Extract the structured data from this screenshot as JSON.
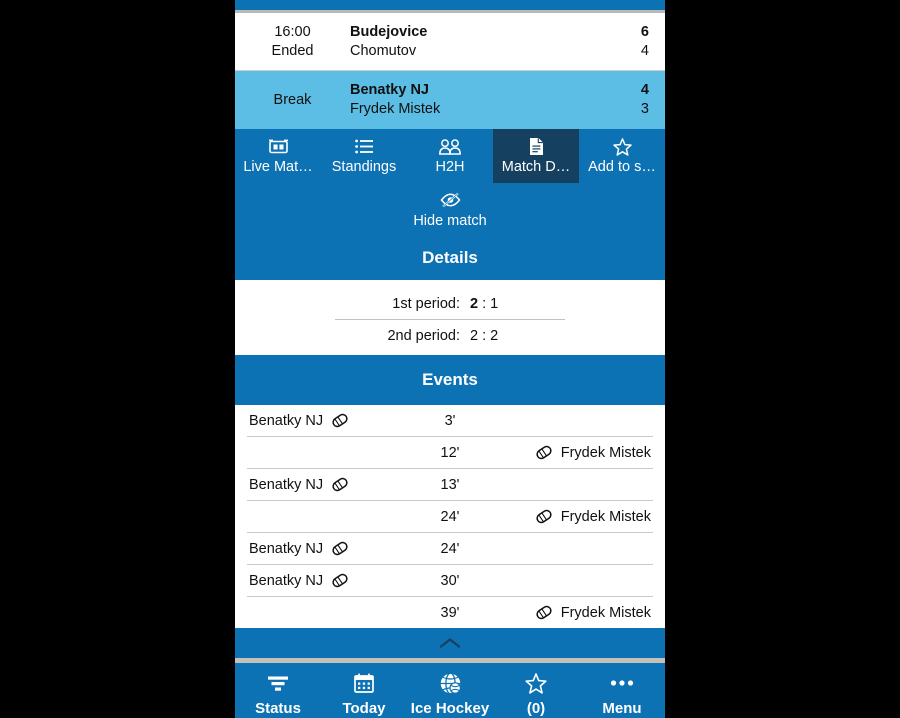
{
  "matches": [
    {
      "time": "16:00",
      "status": "Ended",
      "home_team": "Budejovice",
      "away_team": "Chomutov",
      "home_score": "6",
      "away_score": "4",
      "highlighted": false
    },
    {
      "time": "",
      "status": "Break",
      "home_team": "Benatky NJ",
      "away_team": "Frydek Mistek",
      "home_score": "4",
      "away_score": "3",
      "highlighted": true
    }
  ],
  "tabs": [
    {
      "label": "Live Mat…",
      "icon": "scoreboard-icon",
      "active": false
    },
    {
      "label": "Standings",
      "icon": "list-icon",
      "active": false
    },
    {
      "label": "H2H",
      "icon": "two-people-icon",
      "active": false
    },
    {
      "label": "Match D…",
      "icon": "document-icon",
      "active": true
    },
    {
      "label": "Add to s…",
      "icon": "star-icon",
      "active": false
    }
  ],
  "hide_match": {
    "label": "Hide match",
    "icon": "eye-slash-icon"
  },
  "details": {
    "title": "Details",
    "periods": [
      {
        "label": "1st period:",
        "home": "2",
        "away": "1",
        "bold_home": true
      },
      {
        "label": "2nd period:",
        "home": "2",
        "away": "2",
        "bold_home": false
      }
    ]
  },
  "events": {
    "title": "Events",
    "rows": [
      {
        "side": "left",
        "team": "Benatky NJ",
        "minute": "3'",
        "icon": "hockey-puck-icon"
      },
      {
        "side": "right",
        "team": "Frydek Mistek",
        "minute": "12'",
        "icon": "hockey-puck-icon"
      },
      {
        "side": "left",
        "team": "Benatky NJ",
        "minute": "13'",
        "icon": "hockey-puck-icon"
      },
      {
        "side": "right",
        "team": "Frydek Mistek",
        "minute": "24'",
        "icon": "hockey-puck-icon"
      },
      {
        "side": "left",
        "team": "Benatky NJ",
        "minute": "24'",
        "icon": "hockey-puck-icon"
      },
      {
        "side": "left",
        "team": "Benatky NJ",
        "minute": "30'",
        "icon": "hockey-puck-icon"
      },
      {
        "side": "right",
        "team": "Frydek Mistek",
        "minute": "39'",
        "icon": "hockey-puck-icon"
      }
    ]
  },
  "collapse": {
    "icon": "chevron-up-icon"
  },
  "bottom_nav": [
    {
      "label": "Status",
      "icon": "filter-icon"
    },
    {
      "label": "Today",
      "icon": "calendar-icon"
    },
    {
      "label": "Ice Hockey",
      "icon": "globe-icon"
    },
    {
      "label": "(0)",
      "icon": "star-icon"
    },
    {
      "label": "Menu",
      "icon": "ellipsis-icon"
    }
  ],
  "colors": {
    "primary_blue": "#0d72b3",
    "highlight_blue": "#5cbde5",
    "active_tab_navy": "#16405f",
    "background": "#ffffff",
    "separator": "#c8c8c8"
  }
}
